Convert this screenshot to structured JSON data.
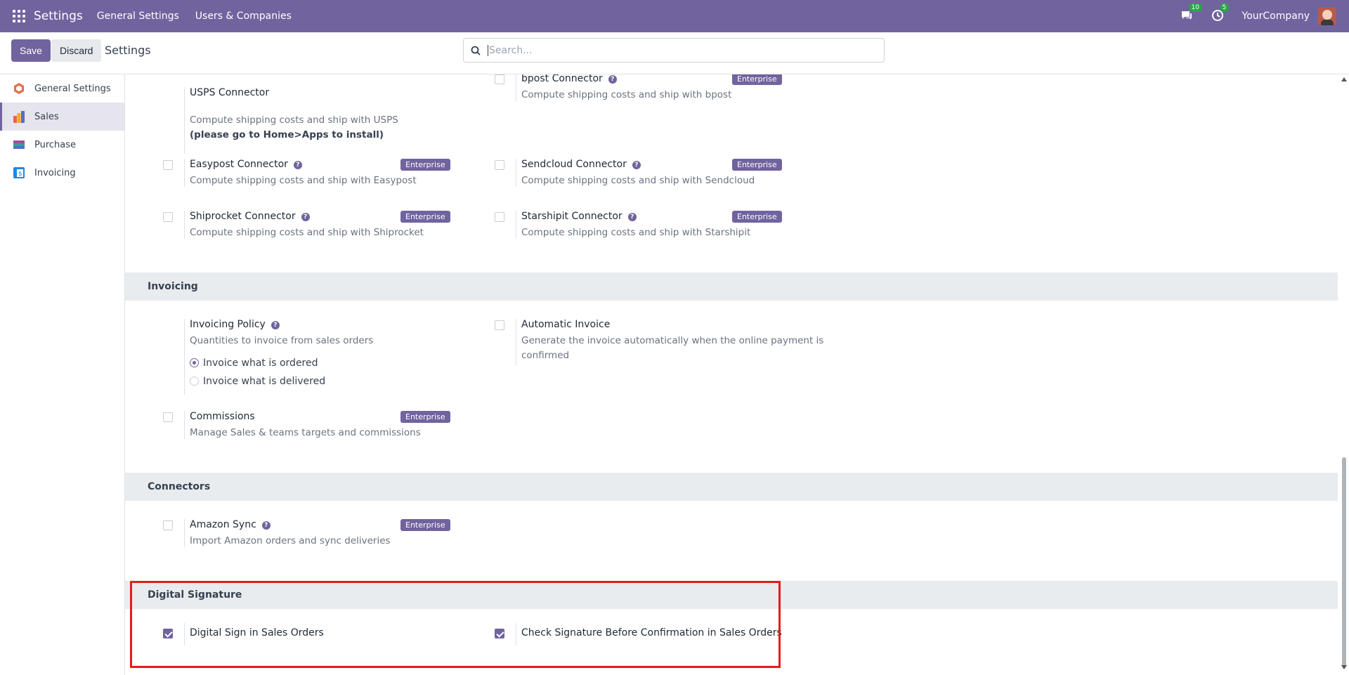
{
  "topbar": {
    "app": "Settings",
    "menu": [
      "General Settings",
      "Users & Companies"
    ],
    "messages_count": "10",
    "activity_count": "5",
    "company": "YourCompany"
  },
  "control": {
    "save": "Save",
    "discard": "Discard",
    "title": "Settings",
    "search_placeholder": "Search..."
  },
  "sidebar": {
    "items": [
      {
        "label": "General Settings",
        "icon": "general-settings-icon",
        "color": "#e46f4e"
      },
      {
        "label": "Sales",
        "icon": "sales-icon",
        "color": "#f06050"
      },
      {
        "label": "Purchase",
        "icon": "purchase-icon",
        "color": "#5c6bc0"
      },
      {
        "label": "Invoicing",
        "icon": "invoicing-icon",
        "color": "#1e88e5"
      }
    ]
  },
  "shipping": {
    "usps": {
      "title": "USPS Connector",
      "desc": "Compute shipping costs and ship with USPS",
      "note": "(please go to Home>Apps to install)"
    },
    "bpost": {
      "title": "bpost Connector",
      "desc": "Compute shipping costs and ship with bpost",
      "badge": "Enterprise"
    },
    "easypost": {
      "title": "Easypost Connector",
      "desc": "Compute shipping costs and ship with Easypost",
      "badge": "Enterprise"
    },
    "sendcloud": {
      "title": "Sendcloud Connector",
      "desc": "Compute shipping costs and ship with Sendcloud",
      "badge": "Enterprise"
    },
    "shiprocket": {
      "title": "Shiprocket Connector",
      "desc": "Compute shipping costs and ship with Shiprocket",
      "badge": "Enterprise"
    },
    "starshipit": {
      "title": "Starshipit Connector",
      "desc": "Compute shipping costs and ship with Starshipit",
      "badge": "Enterprise"
    }
  },
  "invoicing": {
    "header": "Invoicing",
    "policy": {
      "title": "Invoicing Policy",
      "desc": "Quantities to invoice from sales orders",
      "opt1": "Invoice what is ordered",
      "opt2": "Invoice what is delivered",
      "selected": "Invoice what is ordered"
    },
    "auto": {
      "title": "Automatic Invoice",
      "desc1": "Generate the invoice automatically when the online payment is",
      "desc2": "confirmed"
    },
    "commissions": {
      "title": "Commissions",
      "desc": "Manage Sales & teams targets and commissions",
      "badge": "Enterprise"
    }
  },
  "connectors": {
    "header": "Connectors",
    "amazon": {
      "title": "Amazon Sync",
      "desc": "Import Amazon orders and sync deliveries",
      "badge": "Enterprise"
    }
  },
  "digital": {
    "header": "Digital Signature",
    "sign": {
      "title": "Digital Sign in Sales Orders",
      "checked": true
    },
    "check": {
      "title": "Check Signature Before Confirmation in Sales Orders",
      "checked": true
    }
  }
}
